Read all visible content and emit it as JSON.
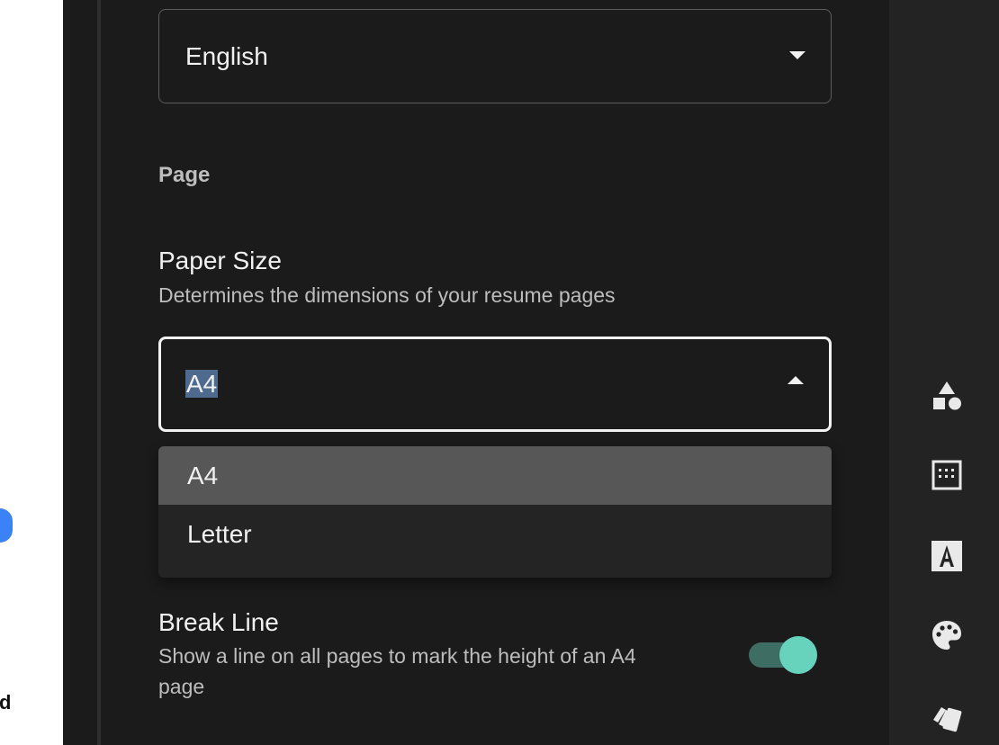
{
  "preview": {
    "text_fragment": "d"
  },
  "language_select": {
    "value": "English"
  },
  "page_section": {
    "label": "Page"
  },
  "paper_size": {
    "title": "Paper Size",
    "description": "Determines the dimensions of your resume pages",
    "value": "A4",
    "options": [
      "A4",
      "Letter"
    ],
    "selected_option": "A4"
  },
  "break_line": {
    "title": "Break Line",
    "description_line1": "Show a line on all pages to mark the height of an A4",
    "description_line2": "page",
    "enabled": true
  },
  "rail_icons": [
    "shapes-icon",
    "layout-grid-icon",
    "typography-icon",
    "palette-icon",
    "theme-cards-icon"
  ],
  "colors": {
    "accent": "#67d3bd",
    "accent_track": "#3e6d63",
    "panel_bg": "#1b1b1b",
    "rail_bg": "#232323",
    "selection_highlight": "#4f6a8f"
  }
}
